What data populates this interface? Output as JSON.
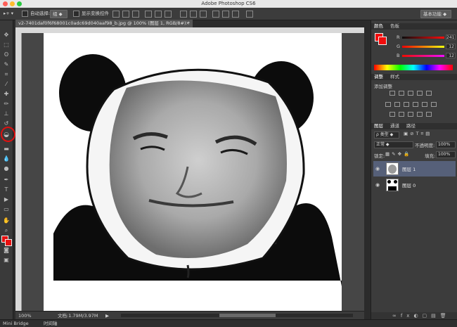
{
  "window": {
    "title": "Adobe Photoshop CS6"
  },
  "options_bar": {
    "auto_select_label": "自动选择:",
    "auto_select_value": "组",
    "show_transform_label": "显示变换控件",
    "workspace": "基本功能"
  },
  "document": {
    "tab_title": "v2-7401daf0f6f68001c0adc69d040aaf98_b.jpg @ 100% (图层 1, RGB/8#) *",
    "zoom": "100%",
    "doc_size": "文档:1.79M/3.97M"
  },
  "bottom_tabs": [
    "Mini Bridge",
    "时间轴"
  ],
  "color_panel": {
    "tabs": [
      "颜色",
      "色板"
    ],
    "channels": [
      {
        "label": "R",
        "value": "241"
      },
      {
        "label": "G",
        "value": "12"
      },
      {
        "label": "B",
        "value": "12"
      }
    ],
    "foreground": "#f10c0c"
  },
  "adjustments_panel": {
    "tabs": [
      "调整",
      "样式"
    ],
    "heading": "添加调整"
  },
  "layers_panel": {
    "tabs": [
      "图层",
      "通道",
      "路径"
    ],
    "filter": "类型",
    "blend_mode": "正常",
    "opacity_label": "不透明度:",
    "opacity_value": "100%",
    "lock_label": "锁定:",
    "fill_label": "填充:",
    "fill_value": "100%",
    "layers": [
      {
        "name": "图层 1",
        "selected": true
      },
      {
        "name": "图层 0",
        "selected": false
      }
    ]
  },
  "colors": {
    "highlight_circle": "#e01010",
    "selected_layer": "#566079"
  }
}
